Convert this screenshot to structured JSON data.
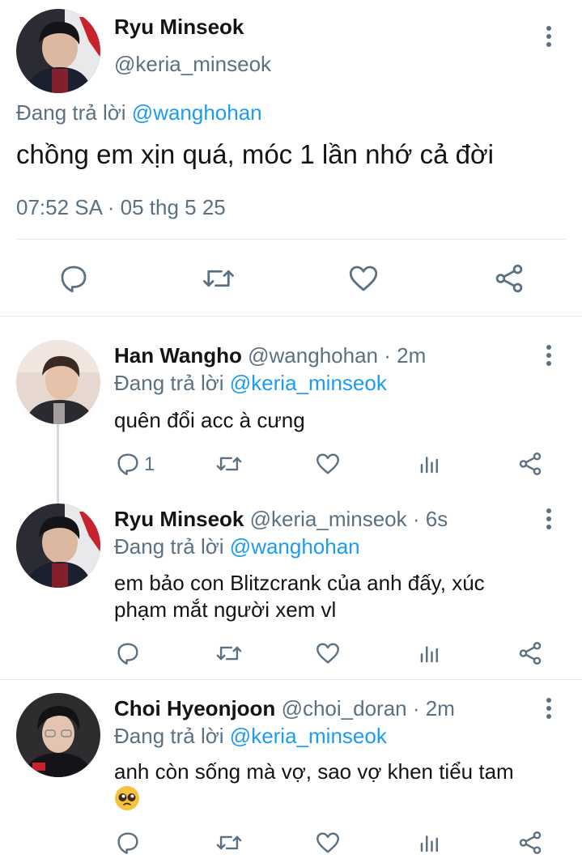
{
  "main_tweet": {
    "display_name": "Ryu Minseok",
    "handle": "@keria_minseok",
    "replying_prefix": "Đang trả lời",
    "replying_to": "@wanghohan",
    "text": "chồng em xịn quá, móc 1 lần nhớ cả đời",
    "timestamp": "07:52 SA · 05 thg 5 25",
    "actions": [
      "reply-icon",
      "retweet-icon",
      "like-icon",
      "share-icon"
    ]
  },
  "replies": [
    {
      "display_name": "Han Wangho",
      "handle": "@wanghohan",
      "time": "· 2m",
      "replying_prefix": "Đang trả lời",
      "replying_to": "@keria_minseok",
      "text": "quên đổi acc à cưng",
      "reply_count": "1"
    },
    {
      "display_name": "Ryu Minseok",
      "handle": "@keria_minseok",
      "time": "· 6s",
      "replying_prefix": "Đang trả lời",
      "replying_to": "@wanghohan",
      "text_line1": "em bảo con Blitzcrank của anh đấy, xúc",
      "text_line2": "phạm mắt người xem vl",
      "reply_count": ""
    },
    {
      "display_name": "Choi Hyeonjoon",
      "handle": "@choi_doran",
      "time": "· 2m",
      "replying_prefix": "Đang trả lời",
      "replying_to": "@keria_minseok",
      "text_line1": "anh còn sống mà vợ, sao vợ khen tiểu tam",
      "emoji": "🥺",
      "reply_count": ""
    }
  ],
  "colors": {
    "accent": "#1d9bf0",
    "muted": "#5b7083",
    "divider": "#e4e9ed"
  }
}
